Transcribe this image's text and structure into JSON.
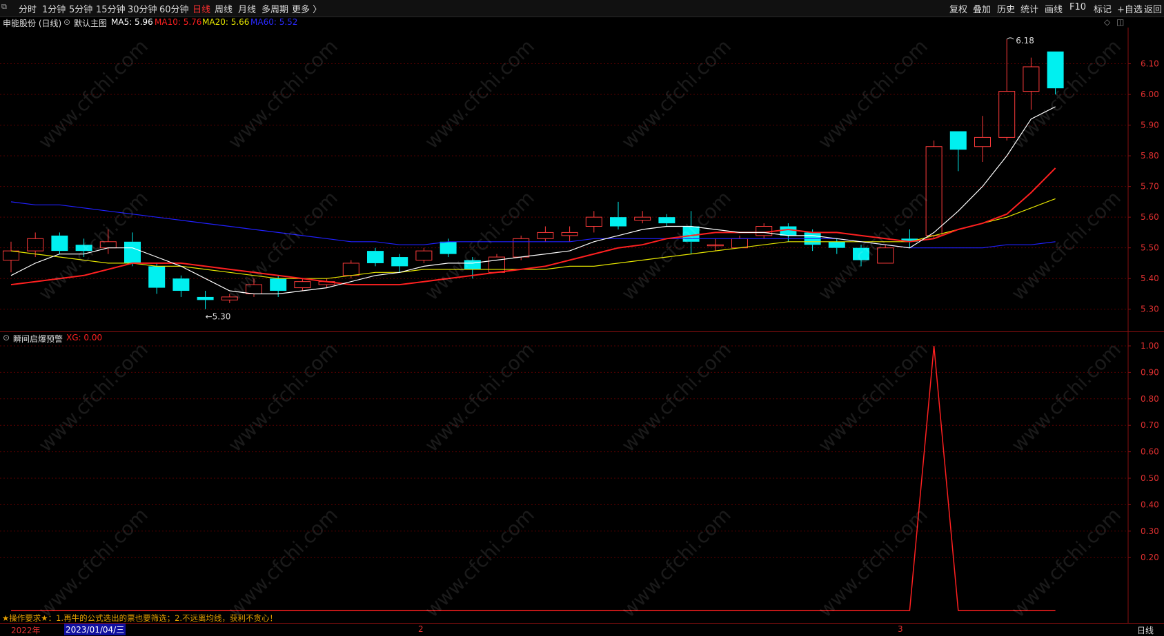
{
  "toolbar": {
    "left_items": [
      "分时",
      "1分钟",
      "5分钟",
      "15分钟",
      "30分钟",
      "60分钟",
      "日线",
      "周线",
      "月线",
      "多周期",
      "更多 〉"
    ],
    "active_item": "日线",
    "right_items": [
      "复权",
      "叠加",
      "历史",
      "统计",
      "画线",
      "F10",
      "+自选",
      "返回"
    ],
    "mark_item": "标记"
  },
  "main_chart": {
    "stock_label": "申能股份 (日线)",
    "template_label": "默认主图",
    "ma5_label": "MA5: 5.96",
    "ma10_label": "MA10: 5.76",
    "ma20_label": "MA20: 5.66",
    "ma60_label": "MA60: 5.52",
    "high_marker": "6.18",
    "low_marker": "5.30",
    "y_ticks": [
      "6.10",
      "6.00",
      "5.90",
      "5.80",
      "5.70",
      "5.60",
      "5.50",
      "5.40",
      "5.30"
    ]
  },
  "indicator": {
    "name": "瞬间启爆预警",
    "value_label": "XG: 0.00",
    "y_ticks": [
      "1.00",
      "0.90",
      "0.80",
      "0.70",
      "0.60",
      "0.50",
      "0.40",
      "0.30",
      "0.20"
    ],
    "note": "★操作要求★：1.再牛的公式选出的票也要筛选；2.不远离均线，获利不贪心！"
  },
  "bottom": {
    "year_label": "2022年",
    "date_label": "2023/01/04/三",
    "tick_2": "2",
    "tick_3": "3",
    "period_label": "日线"
  },
  "watermark": "www.cfchi.com",
  "colors": {
    "up": "#ff3b3b",
    "down": "#00f0f0",
    "ma5": "#ffffff",
    "ma10": "#ff2020",
    "ma20": "#e6e600",
    "ma60": "#2020ff",
    "grid": "#5a0000"
  },
  "chart_data": {
    "type": "candlestick",
    "ylim": [
      5.25,
      6.2
    ],
    "candles": [
      {
        "o": 5.46,
        "c": 5.49,
        "h": 5.52,
        "l": 5.42
      },
      {
        "o": 5.49,
        "c": 5.53,
        "h": 5.55,
        "l": 5.47
      },
      {
        "o": 5.54,
        "c": 5.49,
        "h": 5.55,
        "l": 5.48
      },
      {
        "o": 5.51,
        "c": 5.49,
        "h": 5.53,
        "l": 5.47
      },
      {
        "o": 5.5,
        "c": 5.52,
        "h": 5.56,
        "l": 5.48
      },
      {
        "o": 5.52,
        "c": 5.45,
        "h": 5.55,
        "l": 5.44
      },
      {
        "o": 5.44,
        "c": 5.37,
        "h": 5.45,
        "l": 5.35
      },
      {
        "o": 5.4,
        "c": 5.36,
        "h": 5.41,
        "l": 5.34
      },
      {
        "o": 5.34,
        "c": 5.33,
        "h": 5.36,
        "l": 5.3
      },
      {
        "o": 5.33,
        "c": 5.34,
        "h": 5.35,
        "l": 5.32
      },
      {
        "o": 5.35,
        "c": 5.38,
        "h": 5.4,
        "l": 5.34
      },
      {
        "o": 5.4,
        "c": 5.36,
        "h": 5.41,
        "l": 5.34
      },
      {
        "o": 5.37,
        "c": 5.39,
        "h": 5.4,
        "l": 5.36
      },
      {
        "o": 5.38,
        "c": 5.39,
        "h": 5.4,
        "l": 5.37
      },
      {
        "o": 5.41,
        "c": 5.45,
        "h": 5.46,
        "l": 5.4
      },
      {
        "o": 5.49,
        "c": 5.45,
        "h": 5.5,
        "l": 5.44
      },
      {
        "o": 5.47,
        "c": 5.44,
        "h": 5.48,
        "l": 5.42
      },
      {
        "o": 5.46,
        "c": 5.49,
        "h": 5.5,
        "l": 5.45
      },
      {
        "o": 5.52,
        "c": 5.48,
        "h": 5.53,
        "l": 5.47
      },
      {
        "o": 5.46,
        "c": 5.43,
        "h": 5.47,
        "l": 5.4
      },
      {
        "o": 5.42,
        "c": 5.47,
        "h": 5.48,
        "l": 5.42
      },
      {
        "o": 5.47,
        "c": 5.53,
        "h": 5.54,
        "l": 5.46
      },
      {
        "o": 5.53,
        "c": 5.55,
        "h": 5.57,
        "l": 5.52
      },
      {
        "o": 5.54,
        "c": 5.55,
        "h": 5.57,
        "l": 5.52
      },
      {
        "o": 5.57,
        "c": 5.6,
        "h": 5.62,
        "l": 5.55
      },
      {
        "o": 5.6,
        "c": 5.57,
        "h": 5.65,
        "l": 5.56
      },
      {
        "o": 5.59,
        "c": 5.6,
        "h": 5.62,
        "l": 5.58
      },
      {
        "o": 5.6,
        "c": 5.58,
        "h": 5.61,
        "l": 5.57
      },
      {
        "o": 5.57,
        "c": 5.52,
        "h": 5.62,
        "l": 5.48
      },
      {
        "o": 5.51,
        "c": 5.51,
        "h": 5.53,
        "l": 5.49
      },
      {
        "o": 5.5,
        "c": 5.53,
        "h": 5.54,
        "l": 5.5
      },
      {
        "o": 5.54,
        "c": 5.57,
        "h": 5.58,
        "l": 5.53
      },
      {
        "o": 5.57,
        "c": 5.54,
        "h": 5.58,
        "l": 5.52
      },
      {
        "o": 5.55,
        "c": 5.51,
        "h": 5.56,
        "l": 5.49
      },
      {
        "o": 5.52,
        "c": 5.5,
        "h": 5.53,
        "l": 5.48
      },
      {
        "o": 5.5,
        "c": 5.46,
        "h": 5.51,
        "l": 5.44
      },
      {
        "o": 5.45,
        "c": 5.5,
        "h": 5.51,
        "l": 5.45
      },
      {
        "o": 5.53,
        "c": 5.52,
        "h": 5.56,
        "l": 5.5
      },
      {
        "o": 5.54,
        "c": 5.83,
        "h": 5.85,
        "l": 5.53
      },
      {
        "o": 5.88,
        "c": 5.82,
        "h": 5.88,
        "l": 5.75
      },
      {
        "o": 5.83,
        "c": 5.86,
        "h": 5.93,
        "l": 5.78
      },
      {
        "o": 5.86,
        "c": 6.01,
        "h": 6.18,
        "l": 5.85
      },
      {
        "o": 6.01,
        "c": 6.09,
        "h": 6.12,
        "l": 5.95
      },
      {
        "o": 6.14,
        "c": 6.02,
        "h": 6.14,
        "l": 6.0
      }
    ],
    "ma5": [
      5.41,
      5.45,
      5.48,
      5.48,
      5.5,
      5.5,
      5.47,
      5.44,
      5.4,
      5.36,
      5.35,
      5.35,
      5.36,
      5.37,
      5.39,
      5.41,
      5.42,
      5.44,
      5.45,
      5.45,
      5.46,
      5.47,
      5.48,
      5.49,
      5.52,
      5.54,
      5.56,
      5.57,
      5.57,
      5.56,
      5.55,
      5.55,
      5.54,
      5.54,
      5.53,
      5.52,
      5.51,
      5.5,
      5.55,
      5.62,
      5.7,
      5.8,
      5.92,
      5.96
    ],
    "ma10": [
      5.38,
      5.39,
      5.4,
      5.41,
      5.43,
      5.45,
      5.45,
      5.45,
      5.44,
      5.43,
      5.42,
      5.41,
      5.4,
      5.39,
      5.38,
      5.38,
      5.38,
      5.39,
      5.4,
      5.41,
      5.42,
      5.43,
      5.44,
      5.46,
      5.48,
      5.5,
      5.51,
      5.53,
      5.54,
      5.55,
      5.55,
      5.55,
      5.56,
      5.55,
      5.55,
      5.54,
      5.53,
      5.52,
      5.53,
      5.56,
      5.58,
      5.61,
      5.68,
      5.76
    ],
    "ma20": [
      5.49,
      5.48,
      5.47,
      5.46,
      5.45,
      5.45,
      5.44,
      5.44,
      5.43,
      5.42,
      5.41,
      5.4,
      5.4,
      5.4,
      5.41,
      5.42,
      5.42,
      5.43,
      5.43,
      5.43,
      5.43,
      5.43,
      5.43,
      5.44,
      5.44,
      5.45,
      5.46,
      5.47,
      5.48,
      5.49,
      5.5,
      5.51,
      5.52,
      5.52,
      5.52,
      5.52,
      5.52,
      5.52,
      5.54,
      5.56,
      5.58,
      5.6,
      5.63,
      5.66
    ],
    "ma60": [
      5.65,
      5.64,
      5.64,
      5.63,
      5.62,
      5.61,
      5.6,
      5.59,
      5.58,
      5.57,
      5.56,
      5.55,
      5.54,
      5.53,
      5.52,
      5.52,
      5.51,
      5.51,
      5.52,
      5.52,
      5.52,
      5.52,
      5.52,
      5.52,
      5.53,
      5.53,
      5.53,
      5.53,
      5.53,
      5.53,
      5.53,
      5.53,
      5.53,
      5.53,
      5.53,
      5.52,
      5.51,
      5.5,
      5.5,
      5.5,
      5.5,
      5.51,
      5.51,
      5.52
    ],
    "xg": [
      0,
      0,
      0,
      0,
      0,
      0,
      0,
      0,
      0,
      0,
      0,
      0,
      0,
      0,
      0,
      0,
      0,
      0,
      0,
      0,
      0,
      0,
      0,
      0,
      0,
      0,
      0,
      0,
      0,
      0,
      0,
      0,
      0,
      0,
      0,
      0,
      0,
      0,
      1,
      0,
      0,
      0,
      0,
      0
    ],
    "xg_ylim": [
      0,
      1.1
    ]
  }
}
